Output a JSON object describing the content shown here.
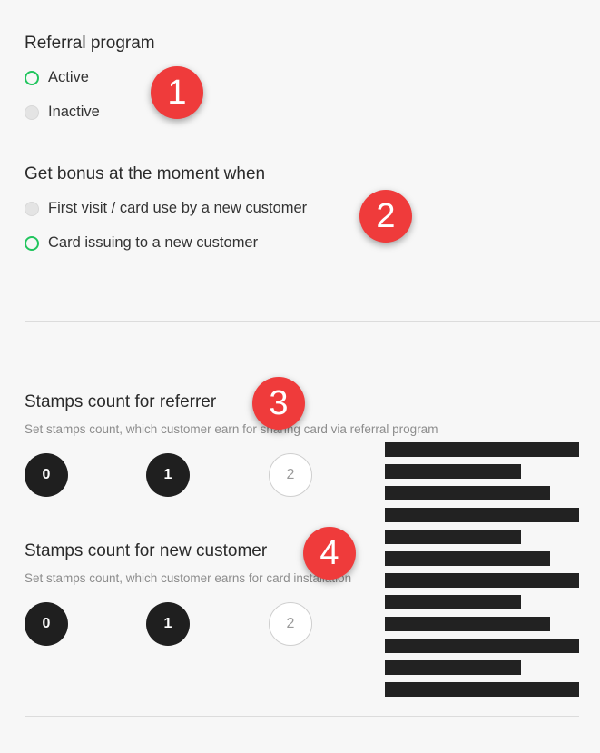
{
  "referral": {
    "title": "Referral program",
    "options": [
      "Active",
      "Inactive"
    ],
    "selected": "Active"
  },
  "bonus": {
    "title": "Get bonus at the moment when",
    "options": [
      "First visit / card use by a new customer",
      "Card issuing to a new customer"
    ],
    "selected": "Card issuing to a new customer"
  },
  "referrer_stamps": {
    "title": "Stamps count for referrer",
    "description": "Set stamps count, which customer earn for sharing card via referral program",
    "options": [
      "0",
      "1",
      "2"
    ]
  },
  "new_customer_stamps": {
    "title": "Stamps count for new customer",
    "description": "Set stamps count, which customer earns for card installation",
    "options": [
      "0",
      "1",
      "2"
    ]
  },
  "badges": [
    "1",
    "2",
    "3",
    "4"
  ],
  "colors": {
    "active_radio": "#22c55e",
    "badge": "#ef3b3b",
    "stamp_dark": "#1f1f1f"
  }
}
